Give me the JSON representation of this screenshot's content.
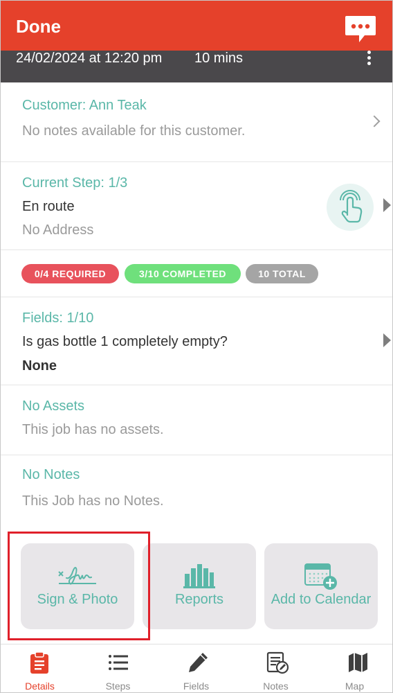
{
  "header": {
    "title": "Done",
    "chat_icon": "chat-bubble-icon",
    "datetime": "24/02/2024 at 12:20 pm",
    "duration": "10 mins",
    "menu_icon": "more-vertical-icon"
  },
  "customer": {
    "title": "Customer: Ann Teak",
    "notes": "No notes available for this customer."
  },
  "current_step": {
    "title": "Current Step: 1/3",
    "step": "En route",
    "address": "No Address",
    "tap_icon": "tap-hand-icon"
  },
  "badges": {
    "required": "0/4 REQUIRED",
    "completed": "3/10 COMPLETED",
    "total": "10 TOTAL"
  },
  "fields": {
    "title": "Fields: 1/10",
    "question": "Is gas bottle 1 completely empty?",
    "answer": "None"
  },
  "assets": {
    "title": "No Assets",
    "text": "This job has no assets."
  },
  "notes": {
    "title": "No Notes",
    "text": "This Job has no Notes."
  },
  "actions": {
    "sign_photo": "Sign & Photo",
    "reports": "Reports",
    "add_calendar": "Add to Calendar"
  },
  "tabs": [
    {
      "label": "Details",
      "icon": "clipboard-icon",
      "active": true
    },
    {
      "label": "Steps",
      "icon": "list-icon",
      "active": false
    },
    {
      "label": "Fields",
      "icon": "pencil-icon",
      "active": false
    },
    {
      "label": "Notes",
      "icon": "notes-icon",
      "active": false
    },
    {
      "label": "Map",
      "icon": "map-icon",
      "active": false
    }
  ],
  "colors": {
    "accent": "#e5412b",
    "teal": "#5ab7a8",
    "subbar": "#4a484b",
    "required": "#e8525c",
    "completed": "#6fe07c",
    "total": "#a5a5a5",
    "highlight": "#e0202a"
  }
}
